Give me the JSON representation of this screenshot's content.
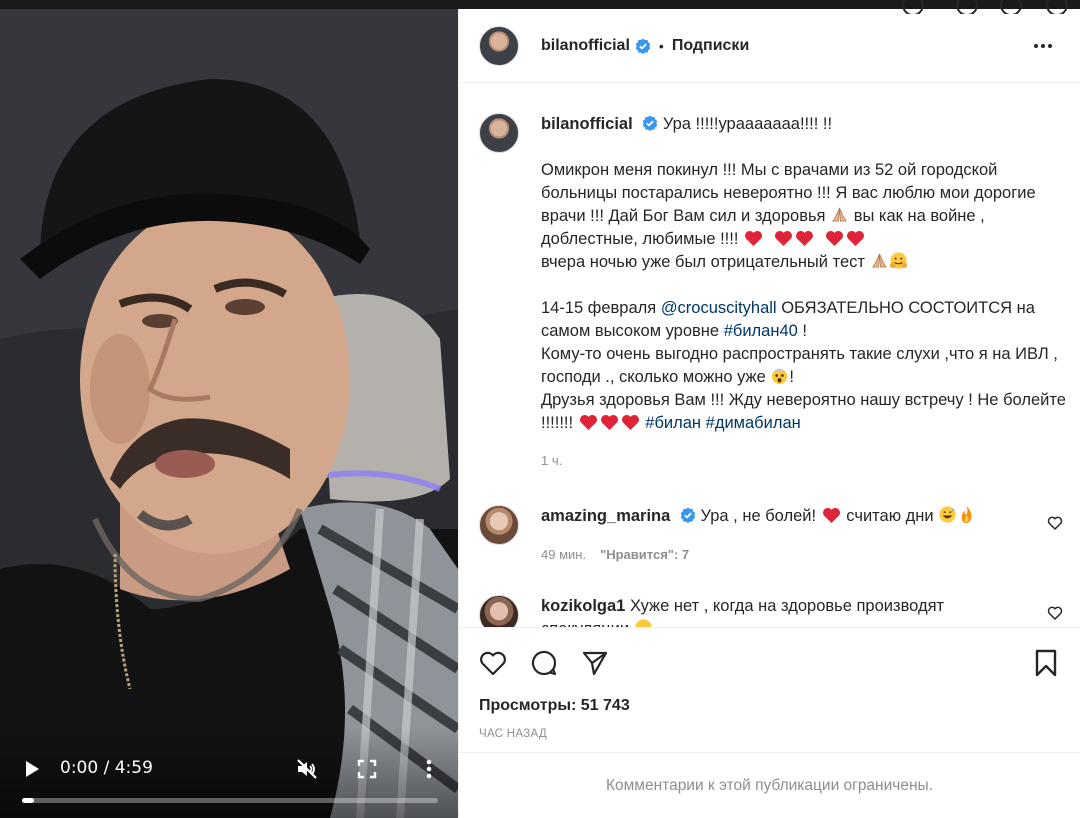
{
  "video": {
    "time": "0:00 / 4:59",
    "progress_fraction": 0.03
  },
  "post": {
    "username": "bilanofficial",
    "separator": "•",
    "follow_label": "Подписки",
    "caption": {
      "username": "bilanofficial",
      "line1": "Ура !!!!!урааааааа!!!! !!",
      "p1a": "Омикрон меня покинул !!! Мы с врачами из 52 ой городской больницы постарались невероятно !!! Я вас люблю мои дорогие врачи !!! Дай Бог Вам сил и здоровья",
      "p1b": "вы как на войне , доблестные, любимые !!!!",
      "p1c": "вчера ночью уже был отрицательный тест",
      "p2a": "14-15 февраля",
      "p2_mention": "@crocuscityhall",
      "p2b": "ОБЯЗАТЕЛЬНО СОСТОИТСЯ на самом высоком уровне",
      "p2_tag": "#билан40",
      "p2c": "!",
      "p3a": "Кому-то очень выгодно распространять такие слухи ,что я на ИВЛ , господи ., сколько можно уже",
      "p3b": "!",
      "p4a": "Друзья здоровья Вам !!! Жду невероятно нашу встречу ! Не болейте !!!!!!!",
      "p4_tag1": "#билан",
      "p4_tag2": "#димабилан",
      "time": "1 ч."
    },
    "comments": [
      {
        "username": "amazing_marina",
        "text_a": "Ура , не болей!",
        "text_b": "считаю дни",
        "time": "49 мин.",
        "likes": "\"Нравится\": 7"
      },
      {
        "username": "kozikolga1",
        "text": "Хуже нет , когда на здоровье производят спекуляции"
      }
    ],
    "views_label": "Просмотры: 51 743",
    "posted_ago": "час назад",
    "restricted_notice": "Комментарии к этой публикации ограничены."
  },
  "colors": {
    "verified": "#3897f0",
    "heart": "#ed4956",
    "link": "#00376b",
    "muted": "#8e8e8e"
  },
  "icons": [
    "play-icon",
    "muted-speaker-icon",
    "fullscreen-icon",
    "more-vertical-icon",
    "verified-badge-icon",
    "more-horizontal-icon",
    "heart-outline-icon",
    "comment-icon",
    "share-icon",
    "bookmark-icon",
    "red-heart-emoji",
    "folded-hands-emoji",
    "hugging-face-emoji",
    "exploding-head-emoji",
    "grinning-sweat-emoji",
    "fire-emoji"
  ]
}
